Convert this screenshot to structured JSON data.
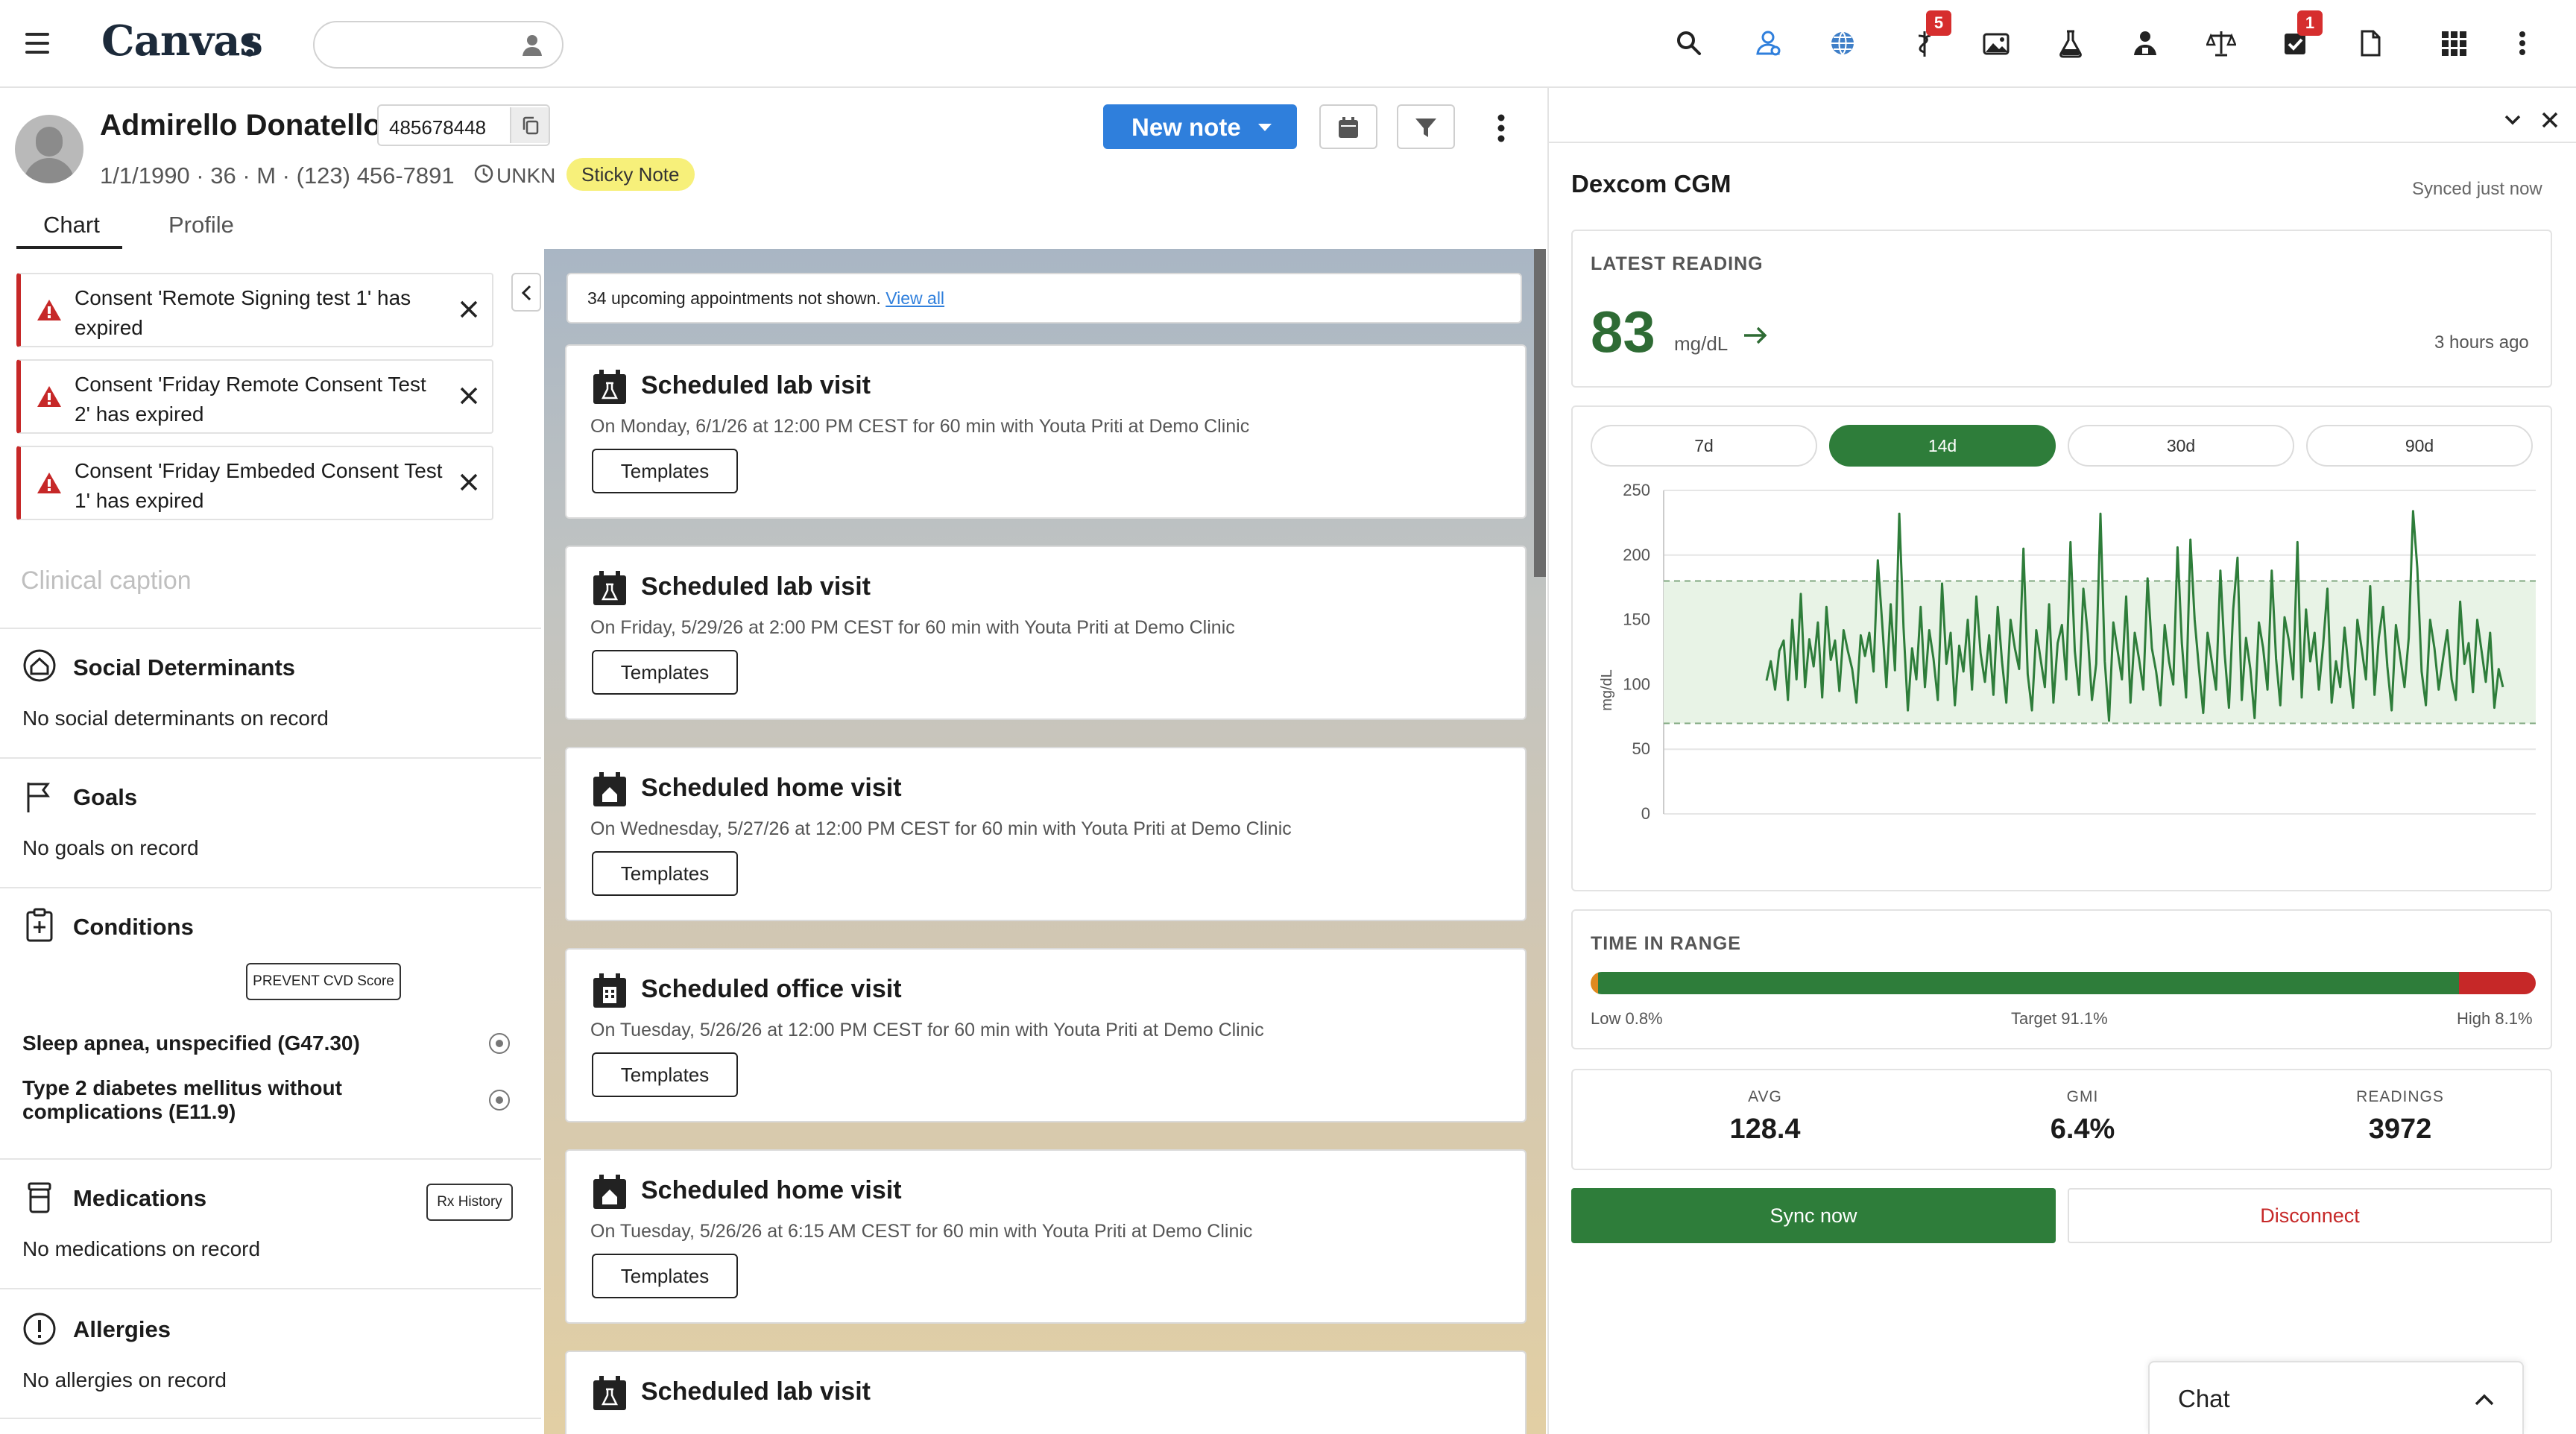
{
  "app": {
    "logo": "Canvas"
  },
  "topbar": {
    "search": {
      "value": "",
      "placeholder": ""
    },
    "icons": [
      {
        "name": "search-icon"
      },
      {
        "name": "patients-icon"
      },
      {
        "name": "globe-icon"
      },
      {
        "name": "caduceus-icon",
        "badge": "5"
      },
      {
        "name": "image-icon"
      },
      {
        "name": "flask-icon"
      },
      {
        "name": "provider-icon"
      },
      {
        "name": "scale-icon"
      },
      {
        "name": "tasks-icon",
        "badge": "1"
      },
      {
        "name": "document-icon"
      },
      {
        "name": "apps-grid-icon"
      },
      {
        "name": "more-vert-icon"
      }
    ],
    "badge_color": "#d62e2e"
  },
  "patient": {
    "name": "Admirello Donatello",
    "mrn": "485678448",
    "demographics": "1/1/1990 · 36 · M · (123) 456-7891",
    "timezone": "UNKN",
    "sticky_note": "Sticky Note"
  },
  "tabs": {
    "chart": "Chart",
    "profile": "Profile"
  },
  "toolbar": {
    "new_note": "New note"
  },
  "alerts": [
    {
      "text": "Consent 'Remote Signing test 1' has expired"
    },
    {
      "text": "Consent 'Friday Remote Consent Test 2' has expired"
    },
    {
      "text": "Consent 'Friday Embeded Consent Test 1' has expired"
    }
  ],
  "clinical_caption": "Clinical caption",
  "sections": {
    "social": {
      "title": "Social Determinants",
      "empty": "No social determinants on record"
    },
    "goals": {
      "title": "Goals",
      "empty": "No goals on record"
    },
    "conditions": {
      "title": "Conditions",
      "prevent_button": "PREVENT CVD Score",
      "items": [
        {
          "label": "Sleep apnea, unspecified (G47.30)"
        },
        {
          "label": "Type 2 diabetes mellitus without complications (E11.9)"
        }
      ]
    },
    "medications": {
      "title": "Medications",
      "rx_button": "Rx History",
      "empty": "No medications on record"
    },
    "allergies": {
      "title": "Allergies",
      "empty": "No allergies on record"
    }
  },
  "timeline": {
    "upcoming_text": "34 upcoming appointments not shown.",
    "view_all": "View all",
    "cards": [
      {
        "title": "Scheduled lab visit",
        "desc": "On Monday, 6/1/26 at 12:00 PM CEST for 60 min with Youta Priti at Demo Clinic",
        "button": "Templates",
        "icon": "lab-calendar-icon"
      },
      {
        "title": "Scheduled lab visit",
        "desc": "On Friday, 5/29/26 at 2:00 PM CEST for 60 min with Youta Priti at Demo Clinic",
        "button": "Templates",
        "icon": "lab-calendar-icon"
      },
      {
        "title": "Scheduled home visit",
        "desc": "On Wednesday, 5/27/26 at 12:00 PM CEST for 60 min with Youta Priti at Demo Clinic",
        "button": "Templates",
        "icon": "home-calendar-icon"
      },
      {
        "title": "Scheduled office visit",
        "desc": "On Tuesday, 5/26/26 at 12:00 PM CEST for 60 min with Youta Priti at Demo Clinic",
        "button": "Templates",
        "icon": "office-calendar-icon"
      },
      {
        "title": "Scheduled home visit",
        "desc": "On Tuesday, 5/26/26 at 6:15 AM CEST for 60 min with Youta Priti at Demo Clinic",
        "button": "Templates",
        "icon": "home-calendar-icon"
      },
      {
        "title": "Scheduled lab visit",
        "desc": "",
        "button": "",
        "icon": "lab-calendar-icon"
      }
    ]
  },
  "cgm": {
    "title": "Dexcom CGM",
    "synced": "Synced just now",
    "latest_label": "LATEST READING",
    "latest_value": "83",
    "latest_unit": "mg/dL",
    "latest_ago": "3 hours ago",
    "ranges": [
      "7d",
      "14d",
      "30d",
      "90d"
    ],
    "active_range": "14d",
    "tir_label": "TIME IN RANGE",
    "tir": {
      "low": {
        "label": "Low 0.8%",
        "value": 0.8,
        "color": "#e08a1e"
      },
      "target": {
        "label": "Target 91.1%",
        "value": 91.1,
        "color": "#2e7d3a"
      },
      "high": {
        "label": "High 8.1%",
        "value": 8.1,
        "color": "#c62828"
      }
    },
    "stats": [
      {
        "label": "AVG",
        "value": "128.4"
      },
      {
        "label": "GMI",
        "value": "6.4%"
      },
      {
        "label": "READINGS",
        "value": "3972"
      }
    ],
    "sync_button": "Sync now",
    "disconnect_button": "Disconnect",
    "accent": "#2e7d3a"
  },
  "chat": {
    "label": "Chat"
  },
  "chart_data": {
    "type": "line",
    "title": "",
    "xlabel": "",
    "ylabel": "mg/dL",
    "ylim": [
      0,
      250
    ],
    "yticks": [
      0,
      50,
      100,
      150,
      200,
      250
    ],
    "target_band": [
      70,
      180
    ],
    "grid": true,
    "series": [
      {
        "values": [
          103,
          118,
          96,
          126,
          134,
          88,
          150,
          104,
          170,
          98,
          135,
          114,
          148,
          90,
          160,
          119,
          134,
          95,
          142,
          126,
          112,
          86,
          138,
          122,
          140,
          110,
          196,
          148,
          98,
          162,
          111,
          232,
          144,
          80,
          128,
          104,
          160,
          98,
          142,
          120,
          88,
          178,
          116,
          140,
          84,
          130,
          110,
          150,
          96,
          168,
          124,
          102,
          138,
          92,
          160,
          118,
          86,
          150,
          128,
          112,
          205,
          108,
          80,
          142,
          120,
          98,
          162,
          86,
          132,
          146,
          104,
          210,
          126,
          92,
          174,
          140,
          88,
          116,
          232,
          118,
          72,
          148,
          126,
          104,
          168,
          86,
          140,
          120,
          96,
          182,
          128,
          110,
          84,
          146,
          118,
          100,
          206,
          132,
          90,
          212,
          150,
          112,
          78,
          140,
          118,
          96,
          188,
          124,
          82,
          158,
          198,
          88,
          136,
          112,
          74,
          148,
          128,
          96,
          188,
          120,
          84,
          152,
          134,
          104,
          210,
          90,
          158,
          118,
          140,
          96,
          130,
          174,
          86,
          118,
          98,
          144,
          110,
          82,
          150,
          128,
          104,
          176,
          92,
          136,
          160,
          114,
          80,
          146,
          122,
          98,
          136,
          234,
          190,
          110,
          84,
          150,
          128,
          96,
          120,
          142,
          104,
          88,
          164,
          116,
          132,
          94,
          150,
          126,
          102,
          140,
          82,
          112,
          98
        ]
      }
    ]
  }
}
